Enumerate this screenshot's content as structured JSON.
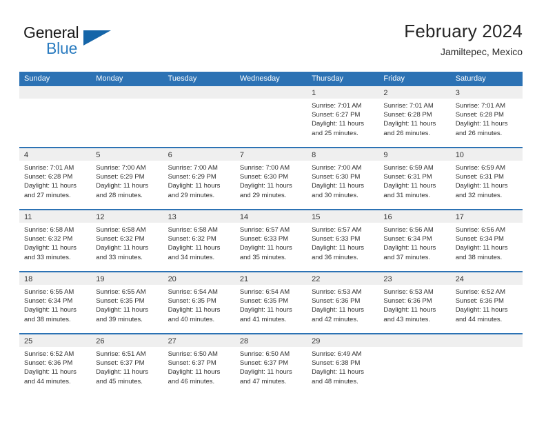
{
  "brand": {
    "word_top": "General",
    "word_bottom": "Blue",
    "flag_icon": "triangle-flag-icon",
    "accent_color": "#1565a8",
    "blue_text_color": "#2b7cc0"
  },
  "header": {
    "title": "February 2024",
    "subtitle": "Jamiltepec, Mexico"
  },
  "calendar": {
    "header_color": "#2c72b4",
    "day_band_color": "#efefef",
    "weekdays": [
      "Sunday",
      "Monday",
      "Tuesday",
      "Wednesday",
      "Thursday",
      "Friday",
      "Saturday"
    ],
    "weeks": [
      [
        {
          "day": "",
          "sunrise": "",
          "sunset": "",
          "daylight_line1": "",
          "daylight_line2": ""
        },
        {
          "day": "",
          "sunrise": "",
          "sunset": "",
          "daylight_line1": "",
          "daylight_line2": ""
        },
        {
          "day": "",
          "sunrise": "",
          "sunset": "",
          "daylight_line1": "",
          "daylight_line2": ""
        },
        {
          "day": "",
          "sunrise": "",
          "sunset": "",
          "daylight_line1": "",
          "daylight_line2": ""
        },
        {
          "day": "1",
          "sunrise": "Sunrise: 7:01 AM",
          "sunset": "Sunset: 6:27 PM",
          "daylight_line1": "Daylight: 11 hours",
          "daylight_line2": "and 25 minutes."
        },
        {
          "day": "2",
          "sunrise": "Sunrise: 7:01 AM",
          "sunset": "Sunset: 6:28 PM",
          "daylight_line1": "Daylight: 11 hours",
          "daylight_line2": "and 26 minutes."
        },
        {
          "day": "3",
          "sunrise": "Sunrise: 7:01 AM",
          "sunset": "Sunset: 6:28 PM",
          "daylight_line1": "Daylight: 11 hours",
          "daylight_line2": "and 26 minutes."
        }
      ],
      [
        {
          "day": "4",
          "sunrise": "Sunrise: 7:01 AM",
          "sunset": "Sunset: 6:28 PM",
          "daylight_line1": "Daylight: 11 hours",
          "daylight_line2": "and 27 minutes."
        },
        {
          "day": "5",
          "sunrise": "Sunrise: 7:00 AM",
          "sunset": "Sunset: 6:29 PM",
          "daylight_line1": "Daylight: 11 hours",
          "daylight_line2": "and 28 minutes."
        },
        {
          "day": "6",
          "sunrise": "Sunrise: 7:00 AM",
          "sunset": "Sunset: 6:29 PM",
          "daylight_line1": "Daylight: 11 hours",
          "daylight_line2": "and 29 minutes."
        },
        {
          "day": "7",
          "sunrise": "Sunrise: 7:00 AM",
          "sunset": "Sunset: 6:30 PM",
          "daylight_line1": "Daylight: 11 hours",
          "daylight_line2": "and 29 minutes."
        },
        {
          "day": "8",
          "sunrise": "Sunrise: 7:00 AM",
          "sunset": "Sunset: 6:30 PM",
          "daylight_line1": "Daylight: 11 hours",
          "daylight_line2": "and 30 minutes."
        },
        {
          "day": "9",
          "sunrise": "Sunrise: 6:59 AM",
          "sunset": "Sunset: 6:31 PM",
          "daylight_line1": "Daylight: 11 hours",
          "daylight_line2": "and 31 minutes."
        },
        {
          "day": "10",
          "sunrise": "Sunrise: 6:59 AM",
          "sunset": "Sunset: 6:31 PM",
          "daylight_line1": "Daylight: 11 hours",
          "daylight_line2": "and 32 minutes."
        }
      ],
      [
        {
          "day": "11",
          "sunrise": "Sunrise: 6:58 AM",
          "sunset": "Sunset: 6:32 PM",
          "daylight_line1": "Daylight: 11 hours",
          "daylight_line2": "and 33 minutes."
        },
        {
          "day": "12",
          "sunrise": "Sunrise: 6:58 AM",
          "sunset": "Sunset: 6:32 PM",
          "daylight_line1": "Daylight: 11 hours",
          "daylight_line2": "and 33 minutes."
        },
        {
          "day": "13",
          "sunrise": "Sunrise: 6:58 AM",
          "sunset": "Sunset: 6:32 PM",
          "daylight_line1": "Daylight: 11 hours",
          "daylight_line2": "and 34 minutes."
        },
        {
          "day": "14",
          "sunrise": "Sunrise: 6:57 AM",
          "sunset": "Sunset: 6:33 PM",
          "daylight_line1": "Daylight: 11 hours",
          "daylight_line2": "and 35 minutes."
        },
        {
          "day": "15",
          "sunrise": "Sunrise: 6:57 AM",
          "sunset": "Sunset: 6:33 PM",
          "daylight_line1": "Daylight: 11 hours",
          "daylight_line2": "and 36 minutes."
        },
        {
          "day": "16",
          "sunrise": "Sunrise: 6:56 AM",
          "sunset": "Sunset: 6:34 PM",
          "daylight_line1": "Daylight: 11 hours",
          "daylight_line2": "and 37 minutes."
        },
        {
          "day": "17",
          "sunrise": "Sunrise: 6:56 AM",
          "sunset": "Sunset: 6:34 PM",
          "daylight_line1": "Daylight: 11 hours",
          "daylight_line2": "and 38 minutes."
        }
      ],
      [
        {
          "day": "18",
          "sunrise": "Sunrise: 6:55 AM",
          "sunset": "Sunset: 6:34 PM",
          "daylight_line1": "Daylight: 11 hours",
          "daylight_line2": "and 38 minutes."
        },
        {
          "day": "19",
          "sunrise": "Sunrise: 6:55 AM",
          "sunset": "Sunset: 6:35 PM",
          "daylight_line1": "Daylight: 11 hours",
          "daylight_line2": "and 39 minutes."
        },
        {
          "day": "20",
          "sunrise": "Sunrise: 6:54 AM",
          "sunset": "Sunset: 6:35 PM",
          "daylight_line1": "Daylight: 11 hours",
          "daylight_line2": "and 40 minutes."
        },
        {
          "day": "21",
          "sunrise": "Sunrise: 6:54 AM",
          "sunset": "Sunset: 6:35 PM",
          "daylight_line1": "Daylight: 11 hours",
          "daylight_line2": "and 41 minutes."
        },
        {
          "day": "22",
          "sunrise": "Sunrise: 6:53 AM",
          "sunset": "Sunset: 6:36 PM",
          "daylight_line1": "Daylight: 11 hours",
          "daylight_line2": "and 42 minutes."
        },
        {
          "day": "23",
          "sunrise": "Sunrise: 6:53 AM",
          "sunset": "Sunset: 6:36 PM",
          "daylight_line1": "Daylight: 11 hours",
          "daylight_line2": "and 43 minutes."
        },
        {
          "day": "24",
          "sunrise": "Sunrise: 6:52 AM",
          "sunset": "Sunset: 6:36 PM",
          "daylight_line1": "Daylight: 11 hours",
          "daylight_line2": "and 44 minutes."
        }
      ],
      [
        {
          "day": "25",
          "sunrise": "Sunrise: 6:52 AM",
          "sunset": "Sunset: 6:36 PM",
          "daylight_line1": "Daylight: 11 hours",
          "daylight_line2": "and 44 minutes."
        },
        {
          "day": "26",
          "sunrise": "Sunrise: 6:51 AM",
          "sunset": "Sunset: 6:37 PM",
          "daylight_line1": "Daylight: 11 hours",
          "daylight_line2": "and 45 minutes."
        },
        {
          "day": "27",
          "sunrise": "Sunrise: 6:50 AM",
          "sunset": "Sunset: 6:37 PM",
          "daylight_line1": "Daylight: 11 hours",
          "daylight_line2": "and 46 minutes."
        },
        {
          "day": "28",
          "sunrise": "Sunrise: 6:50 AM",
          "sunset": "Sunset: 6:37 PM",
          "daylight_line1": "Daylight: 11 hours",
          "daylight_line2": "and 47 minutes."
        },
        {
          "day": "29",
          "sunrise": "Sunrise: 6:49 AM",
          "sunset": "Sunset: 6:38 PM",
          "daylight_line1": "Daylight: 11 hours",
          "daylight_line2": "and 48 minutes."
        },
        {
          "day": "",
          "sunrise": "",
          "sunset": "",
          "daylight_line1": "",
          "daylight_line2": ""
        },
        {
          "day": "",
          "sunrise": "",
          "sunset": "",
          "daylight_line1": "",
          "daylight_line2": ""
        }
      ]
    ]
  }
}
